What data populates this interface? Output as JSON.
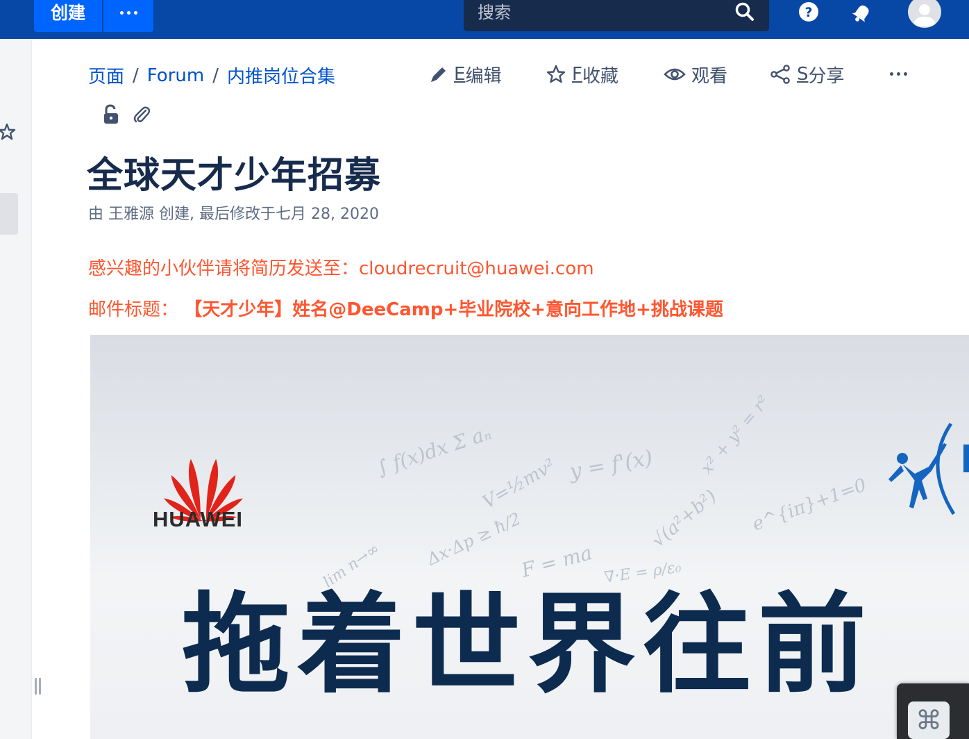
{
  "topbar": {
    "create_label": "创建",
    "search_placeholder": "搜索"
  },
  "breadcrumb": {
    "items": [
      "页面",
      "Forum",
      "内推岗位合集"
    ],
    "separator": "/"
  },
  "actions": {
    "edit": {
      "key": "E",
      "label": "编辑"
    },
    "favorite": {
      "key": "F",
      "label": "收藏"
    },
    "watch": {
      "label": "观看"
    },
    "share": {
      "key": "S",
      "label": "分享"
    }
  },
  "page": {
    "title": "全球天才少年招募",
    "byline": "由 王雅源 创建, 最后修改于七月 28, 2020",
    "contact_prefix": "感兴趣的小伙伴请将简历发送至：",
    "contact_email": "cloudrecruit@huawei.com",
    "subject_prefix": "邮件标题：",
    "subject_value": "【天才少年】姓名@DeeCamp+毕业院校+意向工作地+挑战课题"
  },
  "poster": {
    "brand": "HUAWEI",
    "slogan": "拖着世界往前"
  },
  "colors": {
    "topbar": "#0747a6",
    "create_button": "#0065ff",
    "link": "#0052cc",
    "highlight_text": "#ff5630",
    "slogan": "#0d2b4f"
  }
}
